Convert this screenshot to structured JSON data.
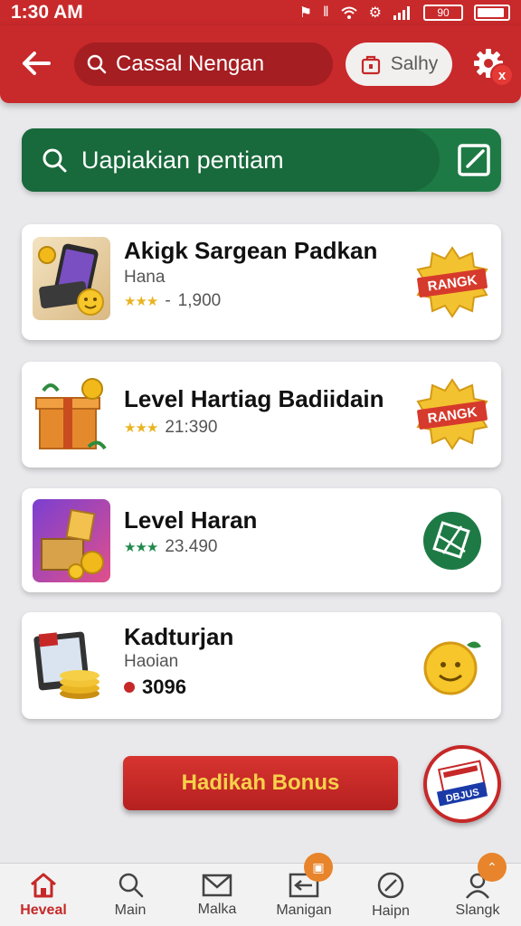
{
  "status_bar": {
    "time": "1:30 AM",
    "battery_label": "90"
  },
  "header": {
    "search_text": "Cassal Nengan",
    "safety_label": "Salhy",
    "close_badge": "x"
  },
  "search_banner": {
    "placeholder": "Uapiakian pentiam"
  },
  "cards": [
    {
      "title": "Akigk Sargean Padkan",
      "subtitle": "Hana",
      "meta": "1,900",
      "stars": "★★★",
      "badge_text": "RANGK",
      "meta_prefix": "-"
    },
    {
      "title": "Level Hartiag Badiidain",
      "meta": "21:390",
      "stars": "★★★",
      "badge_text": "RANGK"
    },
    {
      "title": "Level Haran",
      "meta": "23.490",
      "stars": "★★★"
    },
    {
      "title": "Kadturjan",
      "subtitle": "Haoian",
      "meta": "3096"
    }
  ],
  "bonus": {
    "label": "Hadikah Bonus",
    "badge_text": "DBJUS"
  },
  "nav": [
    {
      "label": "Heveal"
    },
    {
      "label": "Main"
    },
    {
      "label": "Malka"
    },
    {
      "label": "Manigan"
    },
    {
      "label": "Haipn"
    },
    {
      "label": "Slangk"
    }
  ],
  "colors": {
    "brand_red": "#c8292b",
    "brand_green": "#1e7a45",
    "gold": "#e9b422"
  }
}
